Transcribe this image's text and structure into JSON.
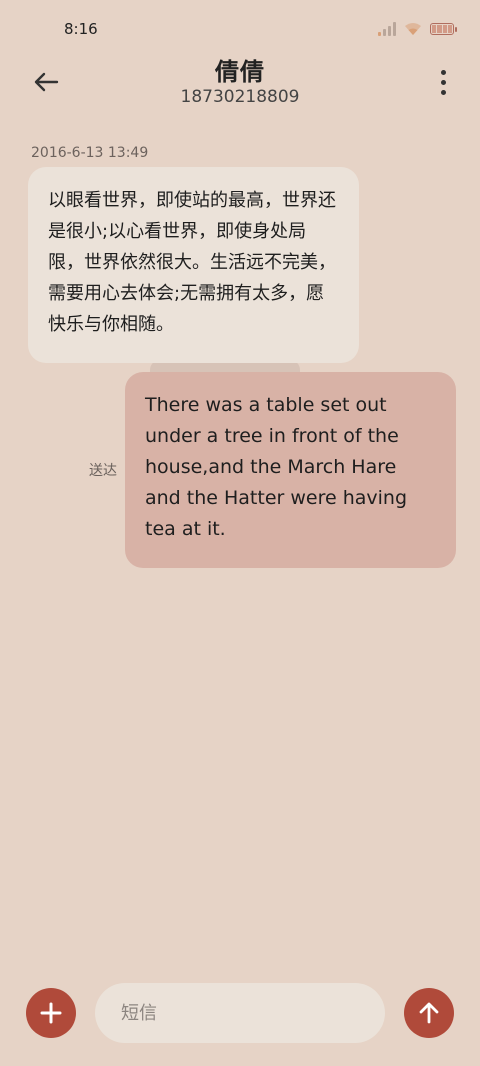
{
  "status_bar": {
    "time": "8:16",
    "icons": [
      "signal-icon",
      "wifi-icon",
      "battery-icon"
    ]
  },
  "header": {
    "contact_name": "倩倩",
    "contact_number": "18730218809"
  },
  "conversation": {
    "timestamp": "2016-6-13 13:49",
    "incoming_message": "以眼看世界，即使站的最高，世界还是很小;以心看世界，即使身处局限，世界依然很大。生活远不完美，需要用心去体会;无需拥有太多，愿快乐与你相随。",
    "outgoing_message": "There was a table set out under a tree in front of the house,and the March Hare and the Hatter were having tea at it.",
    "delivery_status": "送达"
  },
  "composer": {
    "placeholder": "短信"
  },
  "colors": {
    "background": "#e6d3c6",
    "incoming_bubble": "#ebe2d9",
    "outgoing_bubble": "#d8b2a6",
    "accent": "#b04a3a"
  }
}
